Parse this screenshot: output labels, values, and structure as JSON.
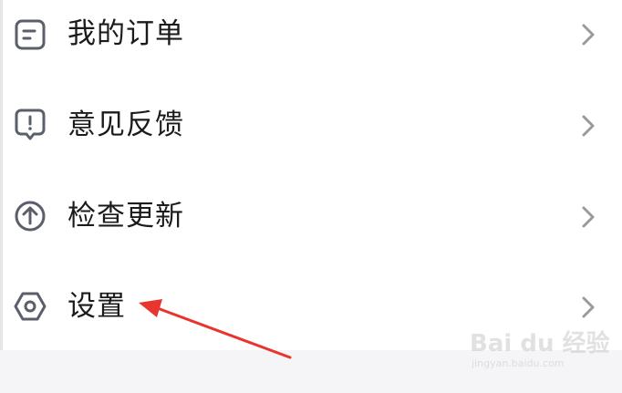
{
  "menu": {
    "items": [
      {
        "label": "我的订单",
        "icon": "order-icon"
      },
      {
        "label": "意见反馈",
        "icon": "feedback-icon"
      },
      {
        "label": "检查更新",
        "icon": "update-icon"
      },
      {
        "label": "设置",
        "icon": "settings-icon"
      }
    ],
    "chevron_icon": "chevron-right-icon"
  },
  "annotation": {
    "arrow_color": "#e8362f",
    "icon": "red-arrow-icon"
  },
  "watermark": {
    "logo": "Bai du 经验",
    "url": "jingyan.baidu.com"
  },
  "colors": {
    "text": "#1b1b1b",
    "icon": "#5a5f6b",
    "chevron": "#9a9a9a",
    "band": "#f5f5f7"
  }
}
